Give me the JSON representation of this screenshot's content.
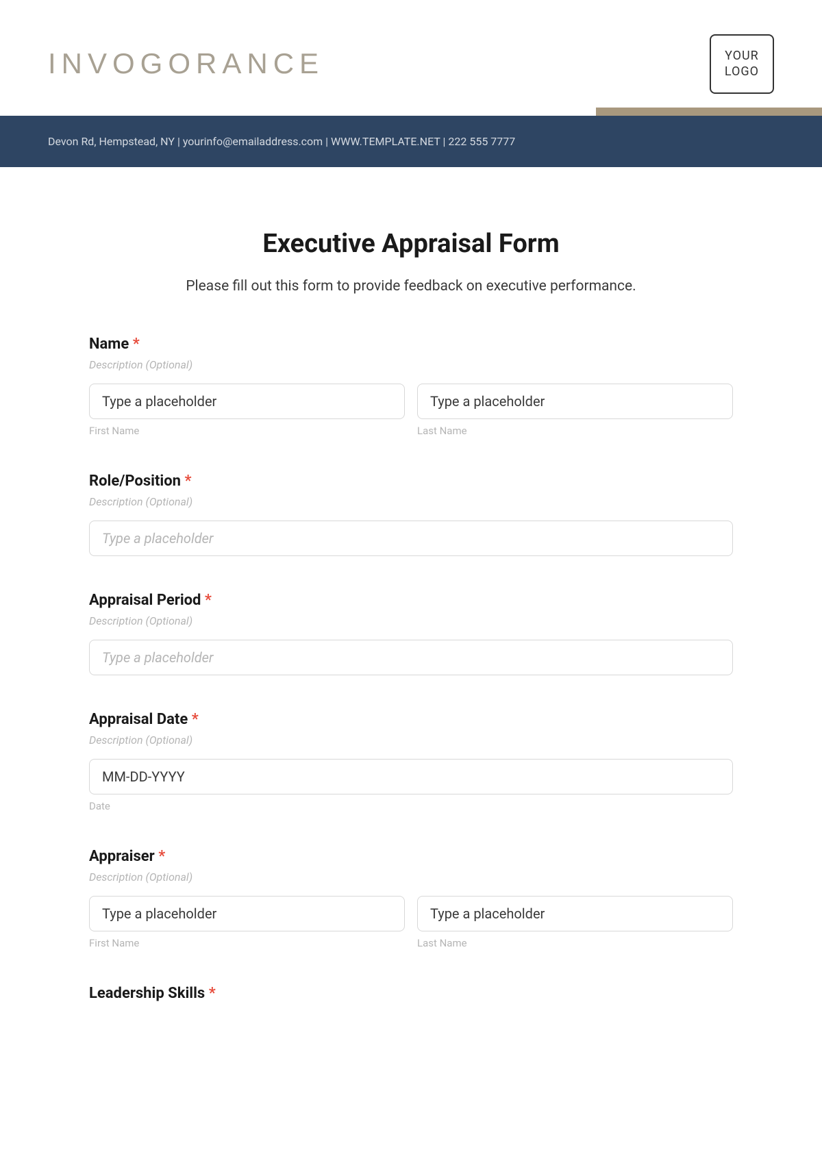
{
  "header": {
    "brand": "INVOGORANCE",
    "logo_line1": "YOUR",
    "logo_line2": "LOGO",
    "info": "Devon Rd, Hempstead, NY | yourinfo@emailaddress.com | WWW.TEMPLATE.NET | 222 555 7777"
  },
  "form": {
    "title": "Executive Appraisal Form",
    "subtitle": "Please fill out this form to provide feedback on executive performance.",
    "description_text": "Description (Optional)",
    "required_mark": "*",
    "fields": {
      "name": {
        "label": "Name",
        "first_placeholder": "Type a placeholder",
        "first_sub": "First Name",
        "last_placeholder": "Type a placeholder",
        "last_sub": "Last Name"
      },
      "role": {
        "label": "Role/Position",
        "placeholder": "Type a placeholder"
      },
      "period": {
        "label": "Appraisal Period",
        "placeholder": "Type a placeholder"
      },
      "date": {
        "label": "Appraisal Date",
        "placeholder": "MM-DD-YYYY",
        "sub": "Date"
      },
      "appraiser": {
        "label": "Appraiser",
        "first_placeholder": "Type a placeholder",
        "first_sub": "First Name",
        "last_placeholder": "Type a placeholder",
        "last_sub": "Last Name"
      },
      "leadership": {
        "label": "Leadership Skills"
      }
    }
  }
}
